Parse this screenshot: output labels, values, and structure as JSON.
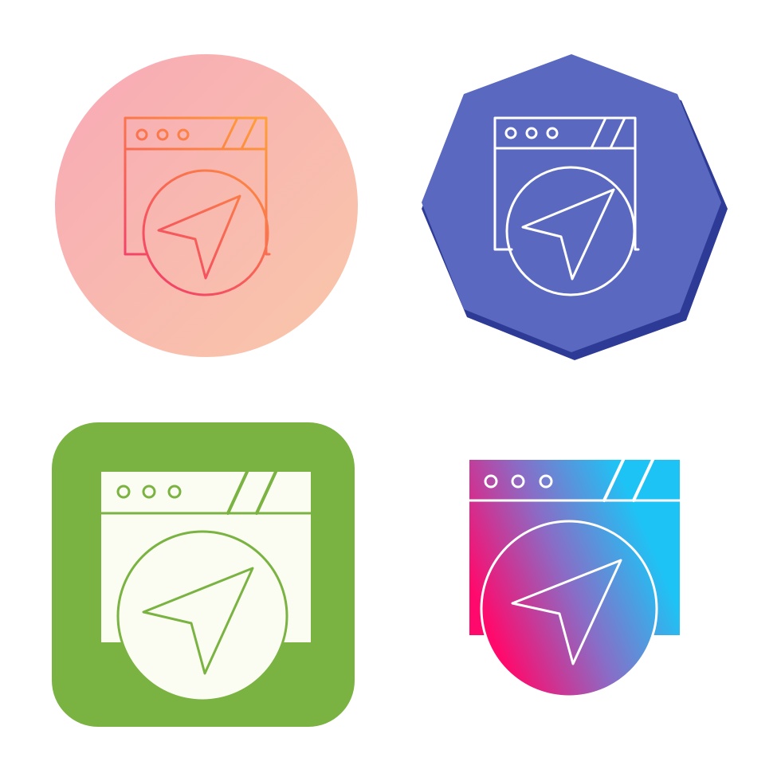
{
  "icons": [
    {
      "name": "web-navigation-icon-gradient-line-circle",
      "style": "gradient-line",
      "badge_shape": "circle",
      "badge_gradient": [
        "#F8A9B6",
        "#F9C8A9"
      ],
      "line_gradient": [
        "#F2376E",
        "#FF9F36"
      ]
    },
    {
      "name": "web-navigation-icon-line-octagon",
      "style": "line",
      "badge_shape": "octagon",
      "badge_color": "#5A69BF",
      "badge_shadow_color": "#2E3B96",
      "line_color": "#FFFFFF"
    },
    {
      "name": "web-navigation-icon-glyph-rounded-square",
      "style": "glyph",
      "badge_shape": "rounded-square",
      "badge_color": "#7AB342",
      "fill_color": "#FBFDF2",
      "line_color": "#7AB342"
    },
    {
      "name": "web-navigation-icon-gradient-glyph",
      "style": "gradient-glyph",
      "badge_shape": "none",
      "fill_gradient": [
        "#FF0A6C",
        "#1EC3F5"
      ],
      "line_color": "#FFFFFF"
    }
  ]
}
